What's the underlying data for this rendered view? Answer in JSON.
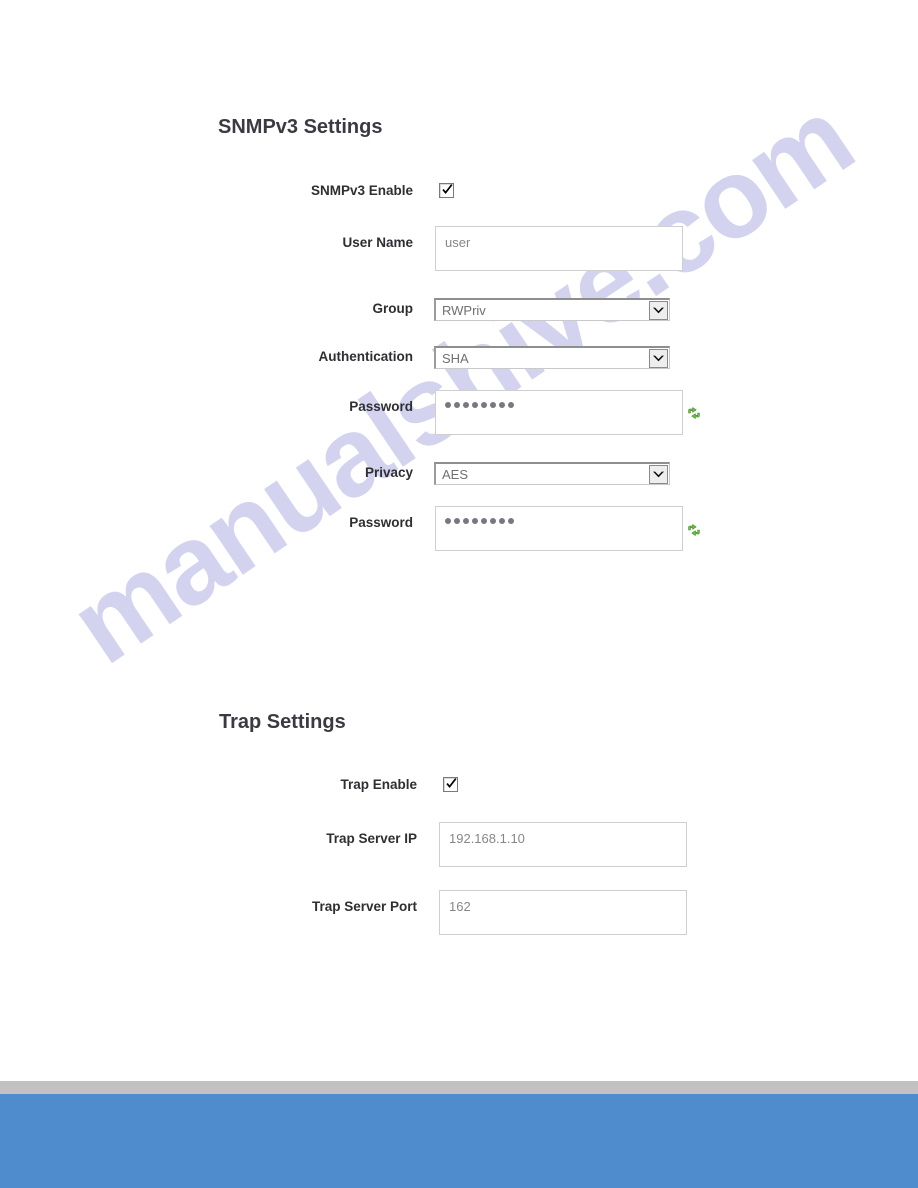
{
  "sections": [
    {
      "id": "snmpv3",
      "title": "SNMPv3 Settings",
      "fields": [
        {
          "label": "SNMPv3 Enable",
          "type": "checkbox",
          "checked": true
        },
        {
          "label": "User Name",
          "type": "text",
          "value": "user"
        },
        {
          "label": "Group",
          "type": "select",
          "value": "RWPriv"
        },
        {
          "label": "Authentication",
          "type": "select",
          "value": "SHA"
        },
        {
          "label": "Password",
          "type": "password",
          "value": "••••••••",
          "dots": 8,
          "action_icon": "refresh-icon"
        },
        {
          "label": "Privacy",
          "type": "select",
          "value": "AES"
        },
        {
          "label": "Password",
          "type": "password",
          "value": "••••••••",
          "dots": 8,
          "action_icon": "refresh-icon"
        }
      ]
    },
    {
      "id": "trap",
      "title": "Trap Settings",
      "fields": [
        {
          "label": "Trap Enable",
          "type": "checkbox",
          "checked": true
        },
        {
          "label": "Trap Server IP",
          "type": "text",
          "value": "192.168.1.10"
        },
        {
          "label": "Trap Server Port",
          "type": "text",
          "value": "162"
        }
      ]
    }
  ],
  "watermark": {
    "text": "manualshive.com",
    "color": "#ccccee"
  },
  "footer": {
    "divider_color": "#c2c0c0",
    "band_color": "#4e8ccd"
  }
}
